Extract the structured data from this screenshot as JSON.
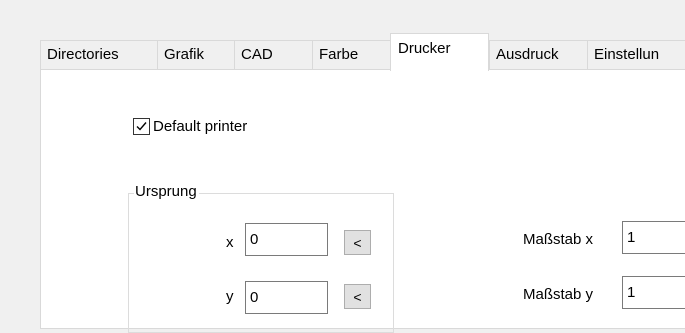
{
  "tabs": [
    {
      "label": "Directories",
      "selected": false
    },
    {
      "label": "Grafik",
      "selected": false
    },
    {
      "label": "CAD",
      "selected": false
    },
    {
      "label": "Farbe",
      "selected": false
    },
    {
      "label": "Drucker",
      "selected": true
    },
    {
      "label": "Ausdruck",
      "selected": false
    },
    {
      "label": "Einstellun",
      "selected": false
    }
  ],
  "default_printer": {
    "label": "Default printer",
    "checked": true
  },
  "origin_group": {
    "title": "Ursprung",
    "x_label": "x",
    "x_value": "0",
    "x_button": "<",
    "y_label": "y",
    "y_value": "0",
    "y_button": "<"
  },
  "scale": {
    "x_label": "Maßstab x",
    "x_value": "1",
    "y_label": "Maßstab y",
    "y_value": "1"
  }
}
